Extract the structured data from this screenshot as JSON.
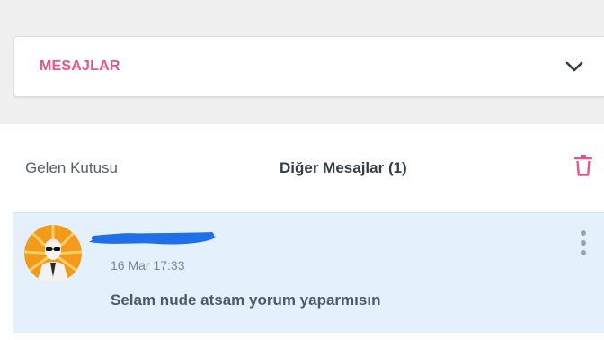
{
  "dropdown": {
    "title": "MESAJLAR",
    "icon": "chevron-down-icon"
  },
  "tabs": {
    "inbox_label": "Gelen Kutusu",
    "other_label": "Diğer Mesajlar (1)",
    "delete_icon": "trash-icon"
  },
  "message": {
    "time": "16 Mar 17:33",
    "text": "Selam nude atsam yorum yaparmısın",
    "avatar_icon": "user-avatar",
    "more_icon": "more-vertical-icon"
  },
  "colors": {
    "accent": "#e4548f",
    "message_bg": "#e4f0fc",
    "redaction": "#1e6fe8"
  }
}
